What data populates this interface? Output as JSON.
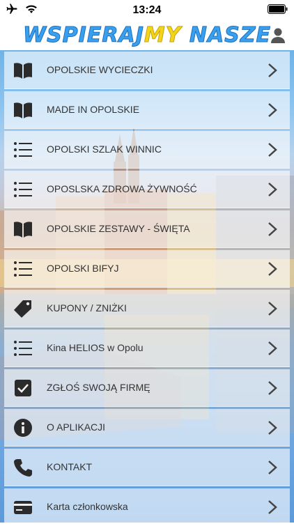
{
  "status_bar": {
    "time": "13:24"
  },
  "header": {
    "title_part1": "WSPIERAJ",
    "title_part2": "MY",
    "title_part3": " NASZE"
  },
  "colors": {
    "accent_blue": "#3399dd",
    "title_blue": "#3aa0ee",
    "title_yellow": "#f2d51b",
    "label": "#333333",
    "icon": "#2b2b2b"
  },
  "menu": {
    "items": [
      {
        "label": "OPOLSKIE WYCIECZKI",
        "icon": "book-icon"
      },
      {
        "label": "MADE IN OPOLSKIE",
        "icon": "book-icon"
      },
      {
        "label": "OPOLSKI SZLAK WINNIC",
        "icon": "list-icon"
      },
      {
        "label": "OPOSLSKA ZDROWA ŻYWNOŚĆ",
        "icon": "list-icon"
      },
      {
        "label": "OPOLSKIE ZESTAWY - ŚWIĘTA",
        "icon": "book-icon"
      },
      {
        "label": "OPOLSKI BIFYJ",
        "icon": "list-icon"
      },
      {
        "label": "KUPONY / ZNIŻKI",
        "icon": "tag-icon"
      },
      {
        "label": "Kina HELIOS w Opolu",
        "icon": "list-icon"
      },
      {
        "label": "ZGŁOŚ SWOJĄ FIRMĘ",
        "icon": "checkbox-icon"
      },
      {
        "label": "O APLIKACJI",
        "icon": "info-icon"
      },
      {
        "label": "KONTAKT",
        "icon": "phone-icon"
      },
      {
        "label": "Karta członkowska",
        "icon": "card-icon"
      }
    ]
  }
}
